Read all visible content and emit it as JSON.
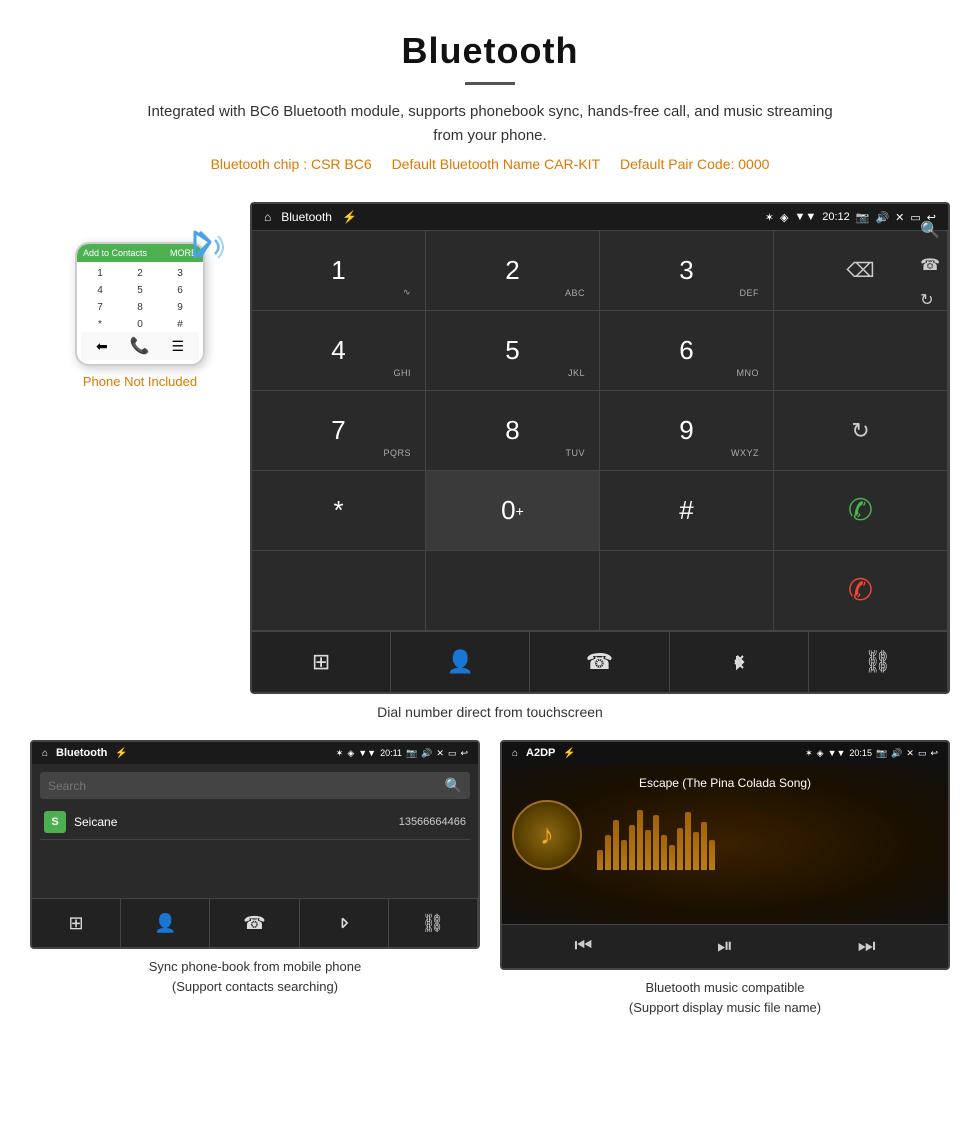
{
  "header": {
    "title": "Bluetooth",
    "description": "Integrated with BC6 Bluetooth module, supports phonebook sync, hands-free call, and music streaming from your phone.",
    "bt_chip": "Bluetooth chip : CSR BC6",
    "bt_name": "Default Bluetooth Name CAR-KIT",
    "bt_pair": "Default Pair Code: 0000"
  },
  "main_screen": {
    "status_bar": {
      "home_icon": "⌂",
      "title": "Bluetooth",
      "usb_icon": "⚡",
      "bt_icon": "✶",
      "loc_icon": "◈",
      "wifi_icon": "▼",
      "time": "20:12",
      "cam_icon": "📷",
      "vol_icon": "🔊",
      "close_icon": "✕",
      "rect_icon": "▭",
      "back_icon": "↩"
    },
    "dial_keys": [
      {
        "num": "1",
        "sub": "∽"
      },
      {
        "num": "2",
        "sub": "ABC"
      },
      {
        "num": "3",
        "sub": "DEF"
      },
      {
        "num": "backspace",
        "sub": ""
      },
      {
        "num": "4",
        "sub": "GHI"
      },
      {
        "num": "5",
        "sub": "JKL"
      },
      {
        "num": "6",
        "sub": "MNO"
      },
      {
        "num": "",
        "sub": ""
      },
      {
        "num": "7",
        "sub": "PQRS"
      },
      {
        "num": "8",
        "sub": "TUV"
      },
      {
        "num": "9",
        "sub": "WXYZ"
      },
      {
        "num": "refresh",
        "sub": ""
      },
      {
        "num": "*",
        "sub": ""
      },
      {
        "num": "0+",
        "sub": ""
      },
      {
        "num": "#",
        "sub": ""
      },
      {
        "num": "call_green",
        "sub": ""
      },
      {
        "num": "",
        "sub": ""
      },
      {
        "num": "call_red",
        "sub": ""
      }
    ],
    "bottom_buttons": [
      "grid",
      "person",
      "phone",
      "bluetooth",
      "link"
    ]
  },
  "dial_caption": "Dial number direct from touchscreen",
  "phone_mock": {
    "header_text": "Add to Contacts",
    "not_included": "Phone Not Included"
  },
  "phonebook_screen": {
    "status_bar": {
      "title": "Bluetooth",
      "time": "20:11"
    },
    "search_placeholder": "Search",
    "contact": {
      "initial": "S",
      "name": "Seicane",
      "number": "13566664466"
    },
    "bottom_buttons": [
      "grid",
      "person",
      "phone",
      "bluetooth",
      "link"
    ]
  },
  "phonebook_caption": "Sync phone-book from mobile phone\n(Support contacts searching)",
  "music_screen": {
    "status_bar": {
      "title": "A2DP",
      "time": "20:15"
    },
    "song_title": "Escape (The Pina Colada Song)",
    "music_note": "♪",
    "eq_heights": [
      20,
      35,
      50,
      30,
      45,
      60,
      40,
      55,
      35,
      25,
      42,
      58,
      38,
      48,
      30
    ],
    "controls": [
      "⏮",
      "⏯",
      "⏭"
    ]
  },
  "music_caption": "Bluetooth music compatible\n(Support display music file name)"
}
